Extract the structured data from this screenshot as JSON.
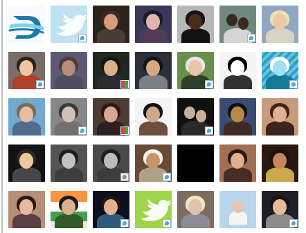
{
  "page": {
    "avatars": [
      {
        "kind": "logo-d",
        "bg": "#f6fbff",
        "badge": "none"
      },
      {
        "kind": "bird",
        "bg": "#bfe1f4",
        "badge": "twitter"
      },
      {
        "kind": "person",
        "bg": "#2c221e",
        "skin": "#d89c7d",
        "hair": "#3a2a20",
        "body": "#4a3b35",
        "badge": "none"
      },
      {
        "kind": "person",
        "bg": "#3b3758",
        "skin": "#e1b4b0",
        "hair": "#1b1b24",
        "body": "#513c57",
        "badge": "none"
      },
      {
        "kind": "person",
        "bg": "#b7b7b7",
        "skin": "#4a2c1d",
        "hair": "#1a120e",
        "body": "#121212",
        "badge": "none"
      },
      {
        "kind": "group",
        "bg": "#6f8a7c",
        "skin": "#3b2a20",
        "hair": "#111",
        "body": "#d5d5d5",
        "badge": "twitter"
      },
      {
        "kind": "person",
        "bg": "#8fa7c1",
        "skin": "#e9c9a8",
        "hair": "#efe1b1",
        "body": "#d8d2c7",
        "badge": "none"
      },
      {
        "kind": "person",
        "bg": "#7a6d67",
        "skin": "#f0c4a4",
        "hair": "#2a2020",
        "body": "#b04028",
        "badge": "twitter"
      },
      {
        "kind": "person",
        "bg": "#5e5872",
        "skin": "#b48e7d",
        "hair": "#4f3c35",
        "body": "#4d4f61",
        "badge": "none"
      },
      {
        "kind": "person",
        "bg": "#1e2821",
        "skin": "#dab08a",
        "hair": "#1a1410",
        "body": "#2a2a30",
        "badge": "cross"
      },
      {
        "kind": "person",
        "bg": "#2d2f3a",
        "skin": "#d8a77d",
        "hair": "#151515",
        "body": "#7a7f88",
        "badge": "none"
      },
      {
        "kind": "person",
        "bg": "#6a8f4a",
        "skin": "#e8c4a9",
        "hair": "#e6e6e6",
        "body": "#2f3f2a",
        "badge": "twitter"
      },
      {
        "kind": "sketch",
        "bg": "#d9d9d9",
        "skin": "#f2f2f2",
        "hair": "#111111",
        "body": "#444444",
        "badge": "none"
      },
      {
        "kind": "pattern",
        "bg": "#24a2c8",
        "skin": "#9ee0ef",
        "hair": "#ffffff",
        "body": "#147a9a",
        "badge": "twitter"
      },
      {
        "kind": "person",
        "bg": "#72a9cf",
        "skin": "#e7bca0",
        "hair": "#7a6b5a",
        "body": "#4f6d8a",
        "badge": "none"
      },
      {
        "kind": "person",
        "bg": "#868686",
        "skin": "#d3c1b5",
        "hair": "#3a3a3a",
        "body": "#707070",
        "badge": "twitter"
      },
      {
        "kind": "person",
        "bg": "#4d3b35",
        "skin": "#d8a98e",
        "hair": "#2a1a16",
        "body": "#2c2020",
        "badge": "cross"
      },
      {
        "kind": "person",
        "bg": "#f3f3f3",
        "skin": "#cfa88a",
        "hair": "#111",
        "body": "#6d4f3b",
        "badge": "none"
      },
      {
        "kind": "group",
        "bg": "#101010",
        "skin": "#c7b09b",
        "hair": "#111",
        "body": "#2a2a2a",
        "badge": "twitter"
      },
      {
        "kind": "person",
        "bg": "#3b4b73",
        "skin": "#b8874b",
        "hair": "#111",
        "body": "#3e2a20",
        "badge": "none"
      },
      {
        "kind": "person",
        "bg": "#c79a7a",
        "skin": "#e3b091",
        "hair": "#3b251c",
        "body": "#3b251c",
        "badge": "none"
      },
      {
        "kind": "cartoon",
        "bg": "#131313",
        "skin": "#efc79c",
        "hair": "#2d2623",
        "body": "#474747",
        "badge": "none"
      },
      {
        "kind": "mono",
        "bg": "#5f5f5f",
        "skin": "#c9c9c9",
        "hair": "#2e2e2e",
        "body": "#4b4b4b",
        "badge": "none"
      },
      {
        "kind": "mono",
        "bg": "#575757",
        "skin": "#c2c2c2",
        "hair": "#2d2d2d",
        "body": "#4a4a4a",
        "badge": "twitter"
      },
      {
        "kind": "person",
        "bg": "#6a4a36",
        "skin": "#c79569",
        "hair": "#f1f1f1",
        "body": "#b0a08a",
        "badge": "twitter"
      },
      {
        "kind": "black",
        "bg": "#000000",
        "badge": "none"
      },
      {
        "kind": "person",
        "bg": "#a26f52",
        "skin": "#e3b08e",
        "hair": "#2a1711",
        "body": "#4b2c22",
        "badge": "none"
      },
      {
        "kind": "person",
        "bg": "#281810",
        "skin": "#c8845c",
        "hair": "#1d120d",
        "body": "#caa94d",
        "badge": "none"
      },
      {
        "kind": "person",
        "bg": "#b58f78",
        "skin": "#e6ba9f",
        "hair": "#2a1a14",
        "body": "#5b3f45",
        "badge": "none"
      },
      {
        "kind": "flag",
        "bg": "#e7e7e7",
        "skin": "#d8b28f",
        "hair": "#1c1c1c",
        "body": "#335b29",
        "badge": "none"
      },
      {
        "kind": "person",
        "bg": "#0d0f20",
        "skin": "#e0b38c",
        "hair": "#24160f",
        "body": "#2f5b7a",
        "badge": "twitter"
      },
      {
        "kind": "bird",
        "bg": "#9fd54a",
        "badge": "twitter"
      },
      {
        "kind": "person",
        "bg": "#7c6d60",
        "skin": "#e0c3ad",
        "hair": "#f3e5c4",
        "body": "#8d8b95",
        "badge": "none"
      },
      {
        "kind": "baby",
        "bg": "#b9d7ea",
        "skin": "#e7c5b1",
        "hair": "#d0a27f",
        "body": "#f4f4f4",
        "badge": "none"
      },
      {
        "kind": "person",
        "bg": "#1f1f2a",
        "skin": "#e8b99c",
        "hair": "#1c1212",
        "body": "#8b8b8b",
        "badge": "twitter"
      }
    ]
  }
}
